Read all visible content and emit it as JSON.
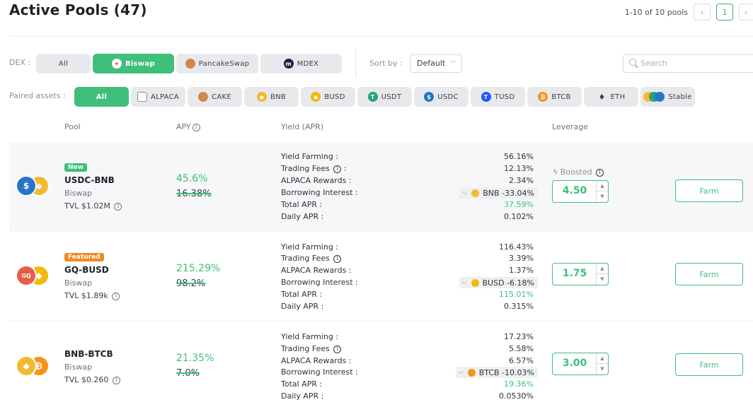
{
  "header": {
    "title": "Active Pools (47)"
  },
  "pagination": {
    "info": "1-10 of 10 pools",
    "prev": "‹",
    "page": "1",
    "next": "›"
  },
  "dex_filter": {
    "label": "DEX :",
    "options": [
      {
        "label": "All",
        "active": false
      },
      {
        "label": "Biswap",
        "active": true
      },
      {
        "label": "PancakeSwap",
        "active": false
      },
      {
        "label": "MDEX",
        "active": false
      }
    ]
  },
  "sort": {
    "label": "Sort by :",
    "value": "Default"
  },
  "search": {
    "placeholder": "Search"
  },
  "paired_assets": {
    "label": "Paired assets :",
    "options": [
      {
        "label": "All",
        "active": true
      },
      {
        "label": "ALPACA"
      },
      {
        "label": "CAKE"
      },
      {
        "label": "BNB"
      },
      {
        "label": "BUSD"
      },
      {
        "label": "USDT"
      },
      {
        "label": "USDC"
      },
      {
        "label": "TUSD"
      },
      {
        "label": "BTCB"
      },
      {
        "label": "ETH"
      },
      {
        "label": "Stable"
      }
    ]
  },
  "table": {
    "columns": {
      "pool": "Pool",
      "apy": "APY",
      "yield": "Yield (APR)",
      "leverage": "Leverage"
    },
    "yield_labels": {
      "farming": "Yield Farming :",
      "fees": "Trading Fees",
      "fees_colon": " :",
      "rewards": "ALPACA Rewards :",
      "borrow": "Borrowing Interest :",
      "total": "Total APR :",
      "daily": "Daily APR :"
    },
    "boosted_label": "Boosted",
    "farm_label": "Farm",
    "rows": [
      {
        "badge": "New",
        "name": "USDC-BNB",
        "dex": "Biswap",
        "tvl": "TVL $1.02M",
        "apy": "45.6%",
        "apy_old": "16.38%",
        "yield_farming": "56.16%",
        "trading_fees": "12.13%",
        "alpaca_rewards": "2.34%",
        "borrow_token": "BNB",
        "borrow_interest": "-33.04%",
        "total_apr": "37.59%",
        "daily_apr": "0.102%",
        "leverage": "4.50"
      },
      {
        "badge": "Featured",
        "name": "GQ-BUSD",
        "dex": "Biswap",
        "tvl": "TVL $1.89k",
        "apy": "215.29%",
        "apy_old": "98.2%",
        "yield_farming": "116.43%",
        "trading_fees": "3.39%",
        "alpaca_rewards": "1.37%",
        "borrow_token": "BUSD",
        "borrow_interest": "-6.18%",
        "total_apr": "115.01%",
        "daily_apr": "0.315%",
        "leverage": "1.75"
      },
      {
        "badge": "",
        "name": "BNB-BTCB",
        "dex": "Biswap",
        "tvl": "TVL $0.260",
        "apy": "21.35%",
        "apy_old": "7.0%",
        "yield_farming": "17.23%",
        "trading_fees": "5.58%",
        "alpaca_rewards": "6.57%",
        "borrow_token": "BTCB",
        "borrow_interest": "-10.03%",
        "total_apr": "19.36%",
        "daily_apr": "0.0530%",
        "leverage": "3.00"
      }
    ]
  },
  "colors": {
    "accent": "#3fbf7a",
    "bnb": "#f3ba2f",
    "usdc": "#2775ca",
    "btc": "#f7931a",
    "featured": "#f08a24"
  }
}
